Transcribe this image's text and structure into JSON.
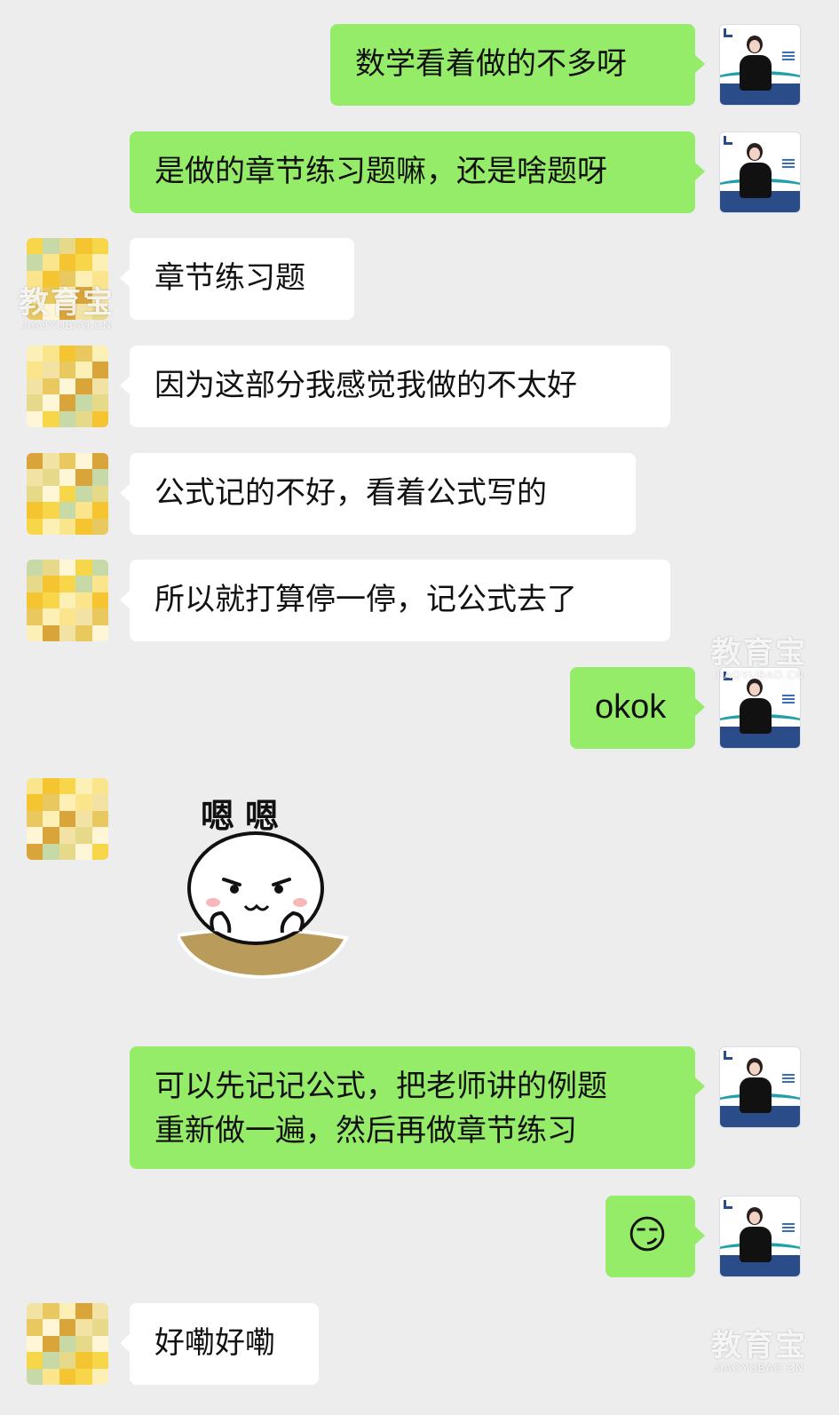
{
  "messages": [
    {
      "sender": "teacher",
      "text": "数学看着做的不多呀"
    },
    {
      "sender": "teacher",
      "text": "是做的章节练习题嘛，还是啥题呀"
    },
    {
      "sender": "student",
      "text": "章节练习题"
    },
    {
      "sender": "student",
      "text": "因为这部分我感觉我做的不太好"
    },
    {
      "sender": "student",
      "text": "公式记的不好，看着公式写的"
    },
    {
      "sender": "student",
      "text": "所以就打算停一停，记公式去了"
    },
    {
      "sender": "teacher",
      "text": "okok"
    },
    {
      "sender": "student",
      "type": "sticker",
      "text": "嗯嗯"
    },
    {
      "sender": "teacher",
      "lines": [
        "可以先记记公式，把老师讲的例题",
        "重新做一遍，然后再做章节练习"
      ]
    },
    {
      "sender": "teacher",
      "type": "emoji",
      "icon": "smug-emoji-icon",
      "text": "😏"
    },
    {
      "sender": "student",
      "text": "好嘞好嘞"
    }
  ],
  "watermark": {
    "main": "教育宝",
    "sub": "JIAOYUBAO.CN"
  },
  "colors": {
    "background": "#ededed",
    "my_bubble": "#95ec69",
    "their_bubble": "#ffffff"
  }
}
